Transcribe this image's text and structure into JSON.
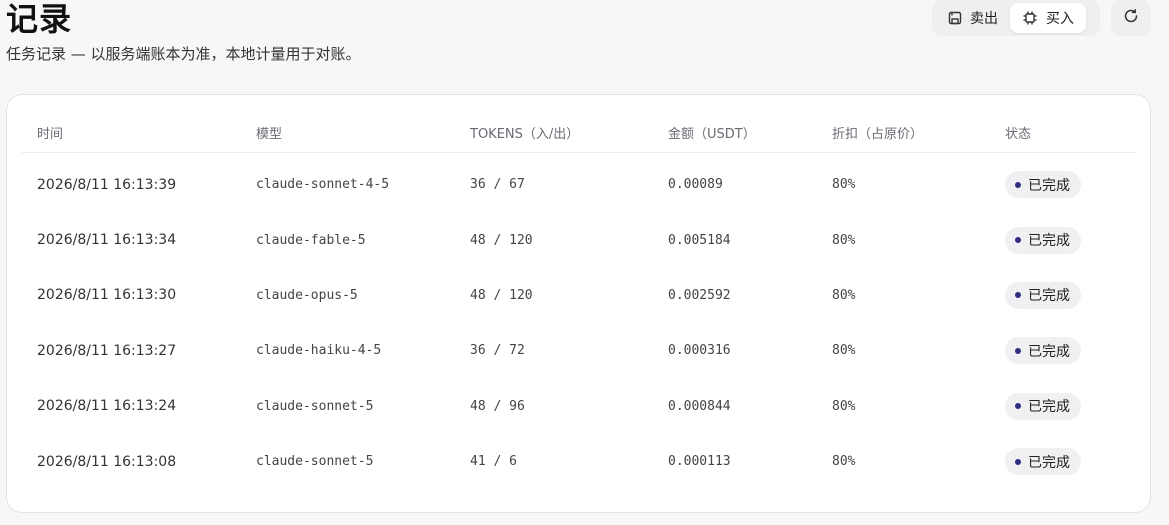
{
  "header": {
    "title": "记录",
    "subtitle": "任务记录 — 以服务端账本为准，本地计量用于对账。"
  },
  "toolbar": {
    "sell_label": "卖出",
    "buy_label": "买入",
    "active": "buy"
  },
  "table": {
    "columns": [
      "时间",
      "模型",
      "TOKENS（入/出）",
      "金额（USDT）",
      "折扣（占原价）",
      "状态"
    ],
    "rows": [
      {
        "time": "2026/8/11 16:13:39",
        "model": "claude-sonnet-4-5",
        "tokens": "36 / 67",
        "amount": "0.00089",
        "discount": "80%",
        "status": "已完成"
      },
      {
        "time": "2026/8/11 16:13:34",
        "model": "claude-fable-5",
        "tokens": "48 / 120",
        "amount": "0.005184",
        "discount": "80%",
        "status": "已完成"
      },
      {
        "time": "2026/8/11 16:13:30",
        "model": "claude-opus-5",
        "tokens": "48 / 120",
        "amount": "0.002592",
        "discount": "80%",
        "status": "已完成"
      },
      {
        "time": "2026/8/11 16:13:27",
        "model": "claude-haiku-4-5",
        "tokens": "36 / 72",
        "amount": "0.000316",
        "discount": "80%",
        "status": "已完成"
      },
      {
        "time": "2026/8/11 16:13:24",
        "model": "claude-sonnet-5",
        "tokens": "48 / 96",
        "amount": "0.000844",
        "discount": "80%",
        "status": "已完成"
      },
      {
        "time": "2026/8/11 16:13:08",
        "model": "claude-sonnet-5",
        "tokens": "41 / 6",
        "amount": "0.000113",
        "discount": "80%",
        "status": "已完成"
      }
    ]
  },
  "icons": {
    "sell": "save-icon",
    "buy": "chip-icon",
    "refresh": "refresh-icon"
  },
  "colors": {
    "status_dot": "#312e81",
    "background": "#f7f7f8",
    "card": "#ffffff"
  }
}
